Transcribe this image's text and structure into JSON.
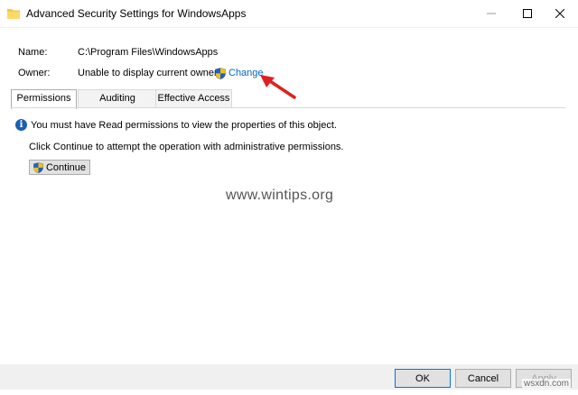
{
  "window": {
    "title": "Advanced Security Settings for WindowsApps"
  },
  "details": {
    "name_label": "Name:",
    "name_value": "C:\\Program Files\\WindowsApps",
    "owner_label": "Owner:",
    "owner_value": "Unable to display current owner.",
    "change_label": "Change"
  },
  "tabs": [
    {
      "label": "Permissions",
      "active": true
    },
    {
      "label": "Auditing",
      "active": false
    },
    {
      "label": "Effective Access",
      "active": false
    }
  ],
  "permissions_panel": {
    "info_message": "You must have Read permissions to view the properties of this object.",
    "continue_message": "Click Continue to attempt the operation with administrative permissions.",
    "continue_button": "Continue"
  },
  "watermark": "www.wintips.org",
  "footer": {
    "ok_label": "OK",
    "cancel_label": "Cancel",
    "apply_label": "Apply",
    "apply_enabled": false
  },
  "site_mark": "wsxdn.com",
  "colors": {
    "link": "#0066cc",
    "arrow": "#e02020",
    "info_icon": "#1b5fb3",
    "folder": "#f5c842"
  },
  "icons": {
    "window": "folder-icon",
    "change": "uac-shield-icon",
    "continue": "uac-shield-icon",
    "info": "info-icon"
  }
}
